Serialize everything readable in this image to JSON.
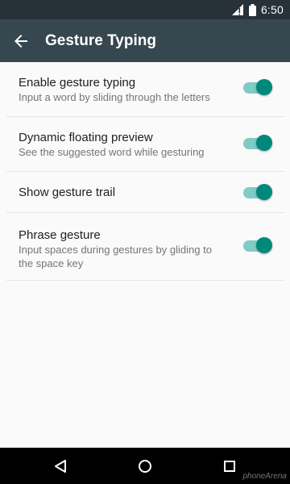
{
  "status_bar": {
    "time": "6:50"
  },
  "app_bar": {
    "title": "Gesture Typing"
  },
  "settings": [
    {
      "title": "Enable gesture typing",
      "summary": "Input a word by sliding through the letters",
      "enabled": true
    },
    {
      "title": "Dynamic floating preview",
      "summary": "See the suggested word while gesturing",
      "enabled": true
    },
    {
      "title": "Show gesture trail",
      "summary": "",
      "enabled": true
    },
    {
      "title": "Phrase gesture",
      "summary": "Input spaces during gestures by gliding to the space key",
      "enabled": true
    }
  ],
  "watermark": "phoneArena",
  "colors": {
    "status_bar": "#263238",
    "app_bar": "#37474f",
    "toggle_thumb": "#00897b",
    "toggle_track": "#80cbc4",
    "background": "#fafafa"
  },
  "icons": {
    "back": "arrow-back-icon",
    "signal": "cell-signal-icon",
    "battery": "battery-icon",
    "nav_back": "triangle-back-icon",
    "nav_home": "circle-home-icon",
    "nav_recents": "square-recents-icon"
  }
}
